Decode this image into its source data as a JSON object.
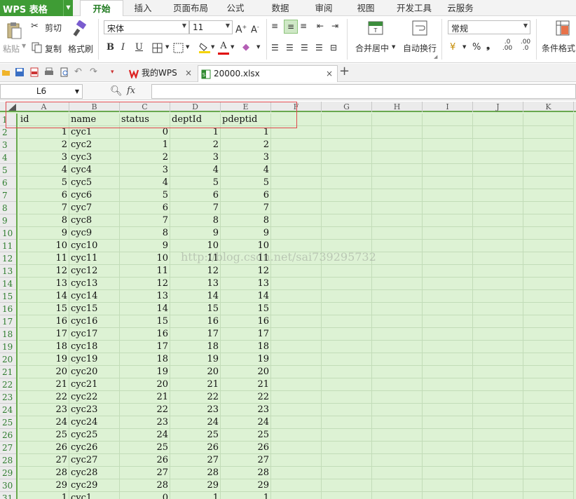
{
  "app": {
    "title": "WPS 表格"
  },
  "tabs": [
    "开始",
    "插入",
    "页面布局",
    "公式",
    "数据",
    "审阅",
    "视图",
    "开发工具",
    "云服务"
  ],
  "active_tab": "开始",
  "ribbon": {
    "paste": "粘贴",
    "cut": "剪切",
    "copy": "复制",
    "format_painter": "格式刷",
    "font_name": "宋体",
    "font_size": "11",
    "bold": "B",
    "italic": "I",
    "underline": "U",
    "merge_center": "合并居中",
    "wrap_text": "自动换行",
    "number_format": "常规",
    "percent": "%",
    "comma": "❟",
    "conditional_format": "条件格式"
  },
  "doc_tabs": [
    {
      "label": "我的WPS",
      "active": false
    },
    {
      "label": "20000.xlsx",
      "active": true
    }
  ],
  "formula_bar": {
    "cell_ref": "L6",
    "fx": "fx",
    "value": ""
  },
  "columns": [
    "A",
    "B",
    "C",
    "D",
    "E",
    "F",
    "G",
    "H",
    "I",
    "J",
    "K"
  ],
  "header_row": [
    "id",
    "name",
    "status",
    "deptId",
    "pdeptid"
  ],
  "rows": [
    [
      1,
      "cyc1",
      0,
      1,
      1
    ],
    [
      2,
      "cyc2",
      1,
      2,
      2
    ],
    [
      3,
      "cyc3",
      2,
      3,
      3
    ],
    [
      4,
      "cyc4",
      3,
      4,
      4
    ],
    [
      5,
      "cyc5",
      4,
      5,
      5
    ],
    [
      6,
      "cyc6",
      5,
      6,
      6
    ],
    [
      7,
      "cyc7",
      6,
      7,
      7
    ],
    [
      8,
      "cyc8",
      7,
      8,
      8
    ],
    [
      9,
      "cyc9",
      8,
      9,
      9
    ],
    [
      10,
      "cyc10",
      9,
      10,
      10
    ],
    [
      11,
      "cyc11",
      10,
      11,
      11
    ],
    [
      12,
      "cyc12",
      11,
      12,
      12
    ],
    [
      13,
      "cyc13",
      12,
      13,
      13
    ],
    [
      14,
      "cyc14",
      13,
      14,
      14
    ],
    [
      15,
      "cyc15",
      14,
      15,
      15
    ],
    [
      16,
      "cyc16",
      15,
      16,
      16
    ],
    [
      17,
      "cyc17",
      16,
      17,
      17
    ],
    [
      18,
      "cyc18",
      17,
      18,
      18
    ],
    [
      19,
      "cyc19",
      18,
      19,
      19
    ],
    [
      20,
      "cyc20",
      19,
      20,
      20
    ],
    [
      21,
      "cyc21",
      20,
      21,
      21
    ],
    [
      22,
      "cyc22",
      21,
      22,
      22
    ],
    [
      23,
      "cyc23",
      22,
      23,
      23
    ],
    [
      24,
      "cyc24",
      23,
      24,
      24
    ],
    [
      25,
      "cyc25",
      24,
      25,
      25
    ],
    [
      26,
      "cyc26",
      25,
      26,
      26
    ],
    [
      27,
      "cyc27",
      26,
      27,
      27
    ],
    [
      28,
      "cyc28",
      27,
      28,
      28
    ],
    [
      29,
      "cyc29",
      28,
      29,
      29
    ],
    [
      1,
      "cyc1",
      0,
      1,
      1
    ]
  ],
  "row_numbers": [
    1,
    2,
    3,
    4,
    5,
    6,
    7,
    8,
    9,
    10,
    11,
    12,
    13,
    14,
    15,
    16,
    17,
    18,
    19,
    20,
    21,
    22,
    23,
    24,
    25,
    26,
    27,
    28,
    29,
    30,
    31
  ],
  "watermark": "http://blog.csdn.net/sai739295732"
}
